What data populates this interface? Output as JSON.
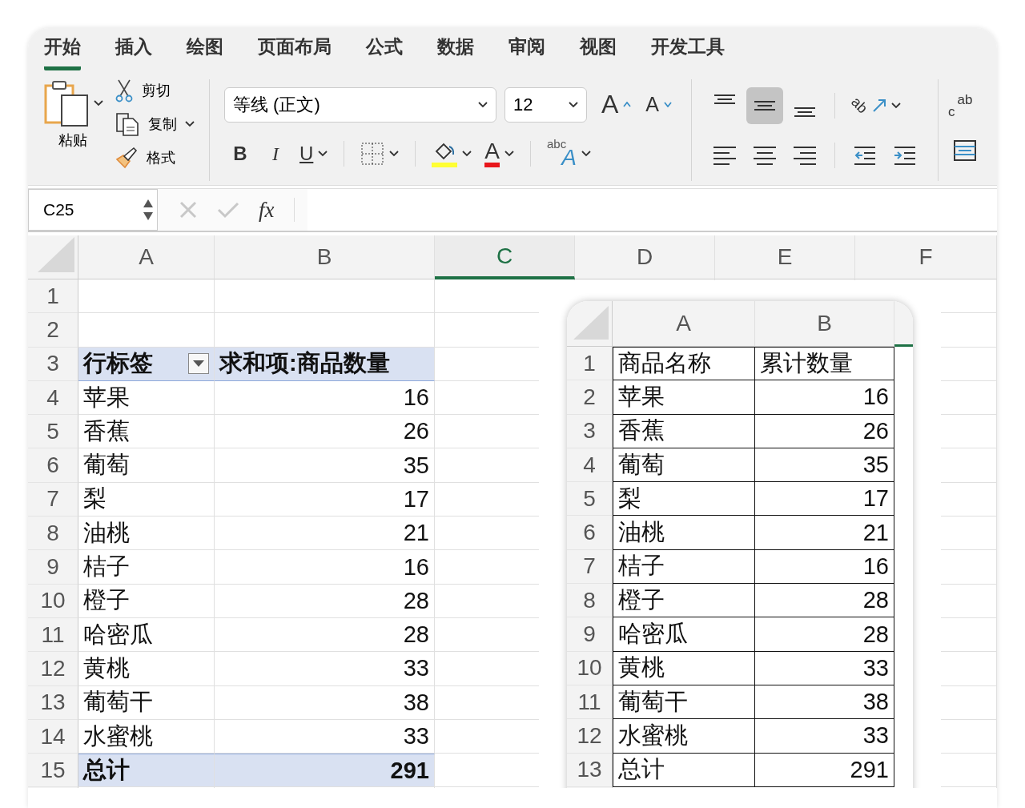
{
  "tabs": [
    {
      "label": "开始",
      "selected": true
    },
    {
      "label": "插入",
      "selected": false
    },
    {
      "label": "绘图",
      "selected": false
    },
    {
      "label": "页面布局",
      "selected": false
    },
    {
      "label": "公式",
      "selected": false
    },
    {
      "label": "数据",
      "selected": false
    },
    {
      "label": "审阅",
      "selected": false
    },
    {
      "label": "视图",
      "selected": false
    },
    {
      "label": "开发工具",
      "selected": false
    }
  ],
  "ribbon": {
    "paste": "粘贴",
    "cut": "剪切",
    "copy": "复制",
    "format_painter": "格式",
    "font_name": "等线 (正文)",
    "font_size": "12",
    "grow_font": "A",
    "shrink_font": "A",
    "bold": "B",
    "italic": "I",
    "underline": "U",
    "font_color": "A",
    "text_effects": {
      "small": "abc",
      "large": "A"
    },
    "orientation": "ab",
    "wrap_text": {
      "top": "ab",
      "bottom": "c"
    },
    "vertical_alignment": [
      {
        "selected": false
      },
      {
        "selected": true
      },
      {
        "selected": false
      }
    ]
  },
  "formula_bar": {
    "name_box": "C25",
    "fx": "fx"
  },
  "sheet": {
    "columns": [
      {
        "label": "A",
        "selected": false
      },
      {
        "label": "B",
        "selected": false
      },
      {
        "label": "C",
        "selected": true
      },
      {
        "label": "D",
        "selected": false
      },
      {
        "label": "E",
        "selected": false
      },
      {
        "label": "F",
        "selected": false
      }
    ],
    "rows": [
      {
        "number": "1",
        "kind": "blank",
        "cells": []
      },
      {
        "number": "2",
        "kind": "blank",
        "cells": []
      },
      {
        "number": "3",
        "kind": "pivot_header",
        "cells": [
          "行标签",
          "求和项:商品数量"
        ]
      },
      {
        "number": "4",
        "kind": "item",
        "cells": [
          "苹果",
          "16"
        ]
      },
      {
        "number": "5",
        "kind": "item",
        "cells": [
          "香蕉",
          "26"
        ]
      },
      {
        "number": "6",
        "kind": "item",
        "cells": [
          "葡萄",
          "35"
        ]
      },
      {
        "number": "7",
        "kind": "item",
        "cells": [
          "梨",
          "17"
        ]
      },
      {
        "number": "8",
        "kind": "item",
        "cells": [
          "油桃",
          "21"
        ]
      },
      {
        "number": "9",
        "kind": "item",
        "cells": [
          "桔子",
          "16"
        ]
      },
      {
        "number": "10",
        "kind": "item",
        "cells": [
          "橙子",
          "28"
        ]
      },
      {
        "number": "11",
        "kind": "item",
        "cells": [
          "哈密瓜",
          "28"
        ]
      },
      {
        "number": "12",
        "kind": "item",
        "cells": [
          "黄桃",
          "33"
        ]
      },
      {
        "number": "13",
        "kind": "item",
        "cells": [
          "葡萄干",
          "38"
        ]
      },
      {
        "number": "14",
        "kind": "item",
        "cells": [
          "水蜜桃",
          "33"
        ]
      },
      {
        "number": "15",
        "kind": "total",
        "cells": [
          "总计",
          "291"
        ]
      }
    ]
  },
  "inset": {
    "columns": [
      {
        "label": "A",
        "selected": false
      },
      {
        "label": "B",
        "selected": false
      }
    ],
    "partial_column_selected": true,
    "rows": [
      {
        "number": "1",
        "cells": [
          "商品名称",
          "累计数量"
        ]
      },
      {
        "number": "2",
        "cells": [
          "苹果",
          "16"
        ]
      },
      {
        "number": "3",
        "cells": [
          "香蕉",
          "26"
        ]
      },
      {
        "number": "4",
        "cells": [
          "葡萄",
          "35"
        ]
      },
      {
        "number": "5",
        "cells": [
          "梨",
          "17"
        ]
      },
      {
        "number": "6",
        "cells": [
          "油桃",
          "21"
        ]
      },
      {
        "number": "7",
        "cells": [
          "桔子",
          "16"
        ]
      },
      {
        "number": "8",
        "cells": [
          "橙子",
          "28"
        ]
      },
      {
        "number": "9",
        "cells": [
          "哈密瓜",
          "28"
        ]
      },
      {
        "number": "10",
        "cells": [
          "黄桃",
          "33"
        ]
      },
      {
        "number": "11",
        "cells": [
          "葡萄干",
          "38"
        ]
      },
      {
        "number": "12",
        "cells": [
          "水蜜桃",
          "33"
        ]
      },
      {
        "number": "13",
        "cells": [
          "总计",
          "291"
        ]
      }
    ]
  }
}
